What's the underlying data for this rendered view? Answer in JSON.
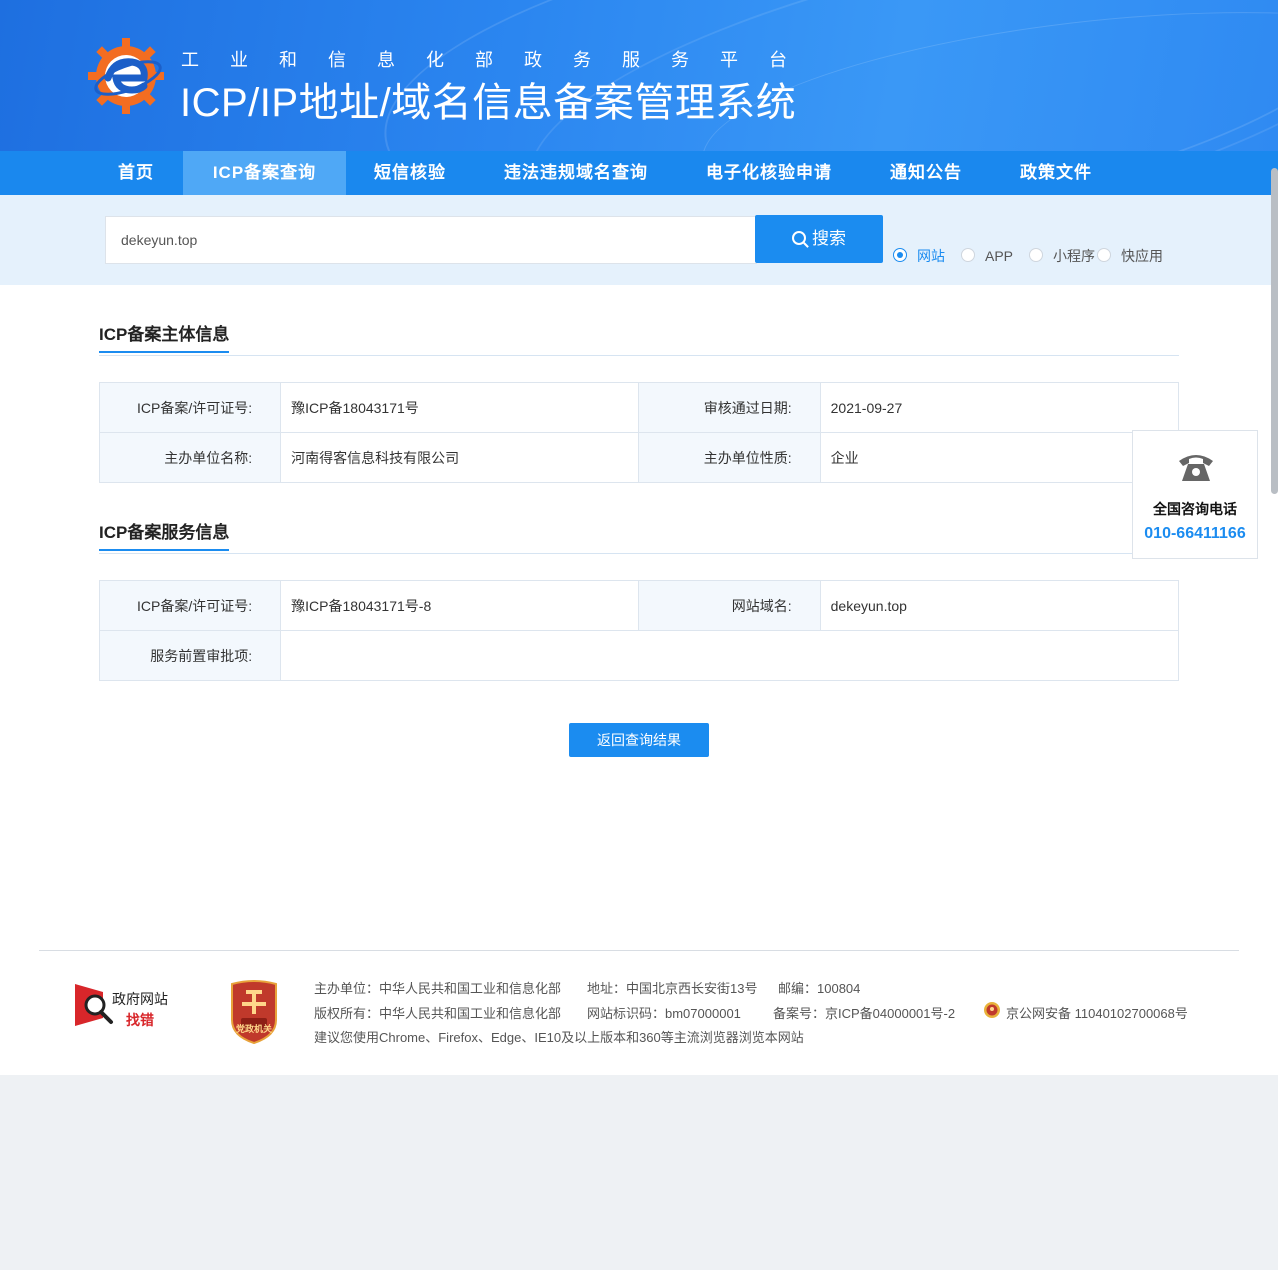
{
  "header": {
    "subtitle": "工业和信息化部政务服务平台",
    "title": "ICP/IP地址/域名信息备案管理系统"
  },
  "nav": {
    "items": [
      {
        "label": "首页",
        "active": false
      },
      {
        "label": "ICP备案查询",
        "active": true
      },
      {
        "label": "短信核验",
        "active": false
      },
      {
        "label": "违法违规域名查询",
        "active": false
      },
      {
        "label": "电子化核验申请",
        "active": false
      },
      {
        "label": "通知公告",
        "active": false
      },
      {
        "label": "政策文件",
        "active": false
      }
    ]
  },
  "search": {
    "value": "dekeyun.top",
    "button_label": "搜索",
    "options": [
      {
        "label": "网站",
        "selected": true
      },
      {
        "label": "APP",
        "selected": false
      },
      {
        "label": "小程序",
        "selected": false
      },
      {
        "label": "快应用",
        "selected": false
      }
    ]
  },
  "subject_info": {
    "title": "ICP备案主体信息",
    "rows": [
      {
        "k1": "ICP备案/许可证号:",
        "v1": "豫ICP备18043171号",
        "k2": "审核通过日期:",
        "v2": "2021-09-27"
      },
      {
        "k1": "主办单位名称:",
        "v1": "河南得客信息科技有限公司",
        "k2": "主办单位性质:",
        "v2": "企业"
      }
    ]
  },
  "service_info": {
    "title": "ICP备案服务信息",
    "rows": [
      {
        "k1": "ICP备案/许可证号:",
        "v1": "豫ICP备18043171号-8",
        "k2": "网站域名:",
        "v2": "dekeyun.top"
      }
    ],
    "approval_label": "服务前置审批项:",
    "approval_value": ""
  },
  "back_button": "返回查询结果",
  "side": {
    "label": "全国咨询电话",
    "phone": "010-66411166"
  },
  "footer": {
    "gov_logo_line1": "政府网站",
    "gov_logo_line2": "找错",
    "party_logo_text": "党政机关",
    "sponsor": "主办单位：中华人民共和国工业和信息化部",
    "address": "地址：中国北京西长安街13号",
    "postcode": "邮编：100804",
    "copyright": "版权所有：中华人民共和国工业和信息化部",
    "site_code": "网站标识码：bm07000001",
    "record_no": "备案号：京ICP备04000001号-2",
    "police_no": "京公网安备 11040102700068号",
    "browser_tip": "建议您使用Chrome、Firefox、Edge、IE10及以上版本和360等主流浏览器浏览本网站"
  },
  "colors": {
    "brand_blue": "#1b8cf0",
    "nav_bg": "#1a88ee",
    "nav_active": "#4fa8f6",
    "search_band": "#e5f1fc"
  }
}
